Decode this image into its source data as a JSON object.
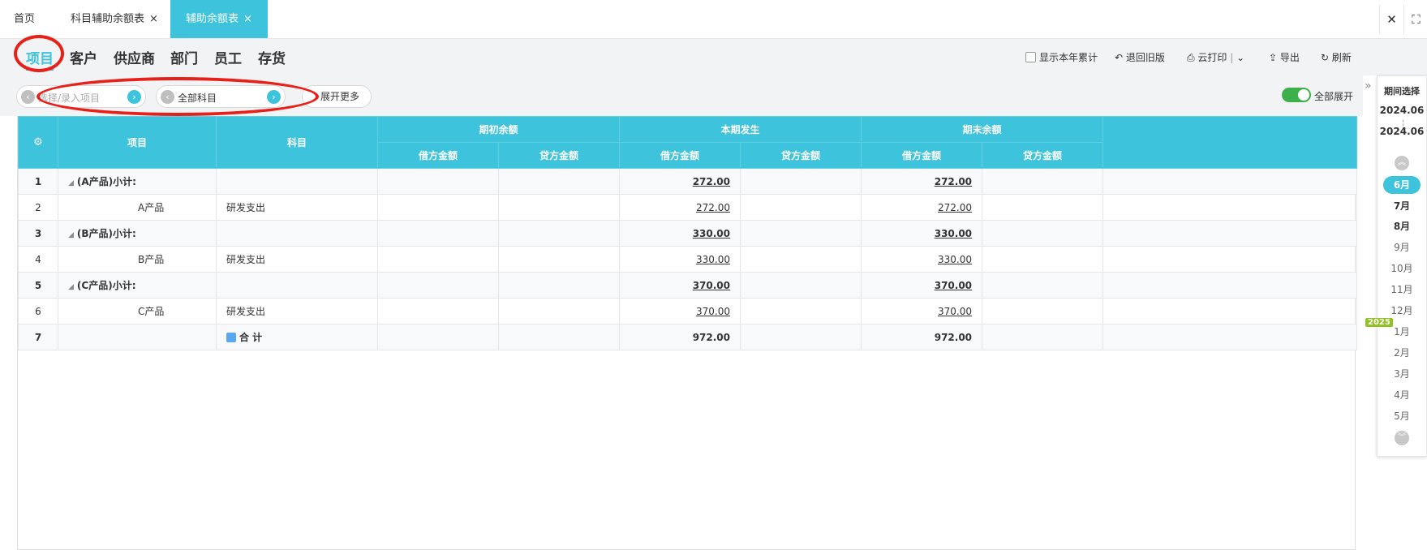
{
  "tabs": {
    "home": "首页",
    "subject_aux": "科目辅助余额表",
    "aux_balance": "辅助余额表",
    "close_glyph": "×"
  },
  "categories": [
    "项目",
    "客户",
    "供应商",
    "部门",
    "员工",
    "存货"
  ],
  "toolbar": {
    "show_cumulative": "显示本年累计",
    "back_old": "退回旧版",
    "cloud_print": "云打印",
    "export": "导出",
    "refresh": "刷新"
  },
  "filters": {
    "project_placeholder": "选择/录入项目",
    "subject_value": "全部科目",
    "expand_more": "展开更多",
    "expand_all": "全部展开"
  },
  "table": {
    "headers": {
      "item": "项目",
      "subject": "科目",
      "opening": "期初余额",
      "current": "本期发生",
      "ending": "期末余额",
      "debit": "借方金额",
      "credit": "贷方金额"
    },
    "rows": [
      {
        "idx": "1",
        "item": "(A产品)小计:",
        "subject": "",
        "cur_debit": "272.00",
        "end_debit": "272.00",
        "type": "sub"
      },
      {
        "idx": "2",
        "item": "A产品",
        "subject": "研发支出",
        "cur_debit": "272.00",
        "end_debit": "272.00",
        "type": "detail"
      },
      {
        "idx": "3",
        "item": "(B产品)小计:",
        "subject": "",
        "cur_debit": "330.00",
        "end_debit": "330.00",
        "type": "sub"
      },
      {
        "idx": "4",
        "item": "B产品",
        "subject": "研发支出",
        "cur_debit": "330.00",
        "end_debit": "330.00",
        "type": "detail"
      },
      {
        "idx": "5",
        "item": "(C产品)小计:",
        "subject": "",
        "cur_debit": "370.00",
        "end_debit": "370.00",
        "type": "sub"
      },
      {
        "idx": "6",
        "item": "C产品",
        "subject": "研发支出",
        "cur_debit": "370.00",
        "end_debit": "370.00",
        "type": "detail"
      },
      {
        "idx": "7",
        "item": "",
        "subject": "合 计",
        "cur_debit": "972.00",
        "end_debit": "972.00",
        "type": "total"
      }
    ]
  },
  "period_panel": {
    "title": "期间选择",
    "start": "2024.06",
    "end": "2024.06",
    "year_badge": "2025",
    "months": [
      "6月",
      "7月",
      "8月",
      "9月",
      "10月",
      "11月",
      "12月",
      "1月",
      "2月",
      "3月",
      "4月",
      "5月"
    ],
    "selected": "6月"
  },
  "colors": {
    "accent": "#3dc3dc",
    "annotation": "#e8201a",
    "toggle_on": "#3cb04b"
  }
}
